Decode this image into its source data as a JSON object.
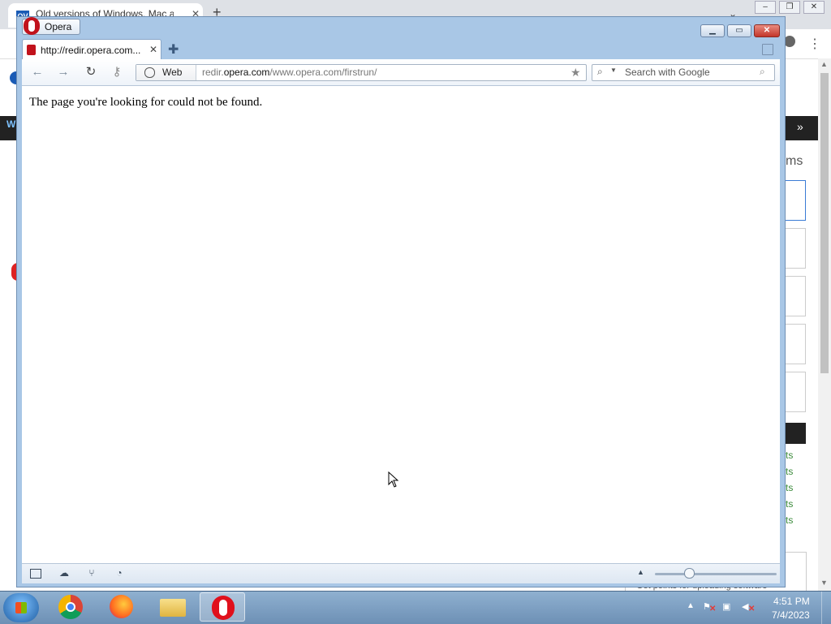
{
  "background_browser": {
    "tab_favicon_text": "OV",
    "tab_title": "Old versions of Windows, Mac a",
    "sidebar_heading": "ms",
    "footer_text": "Get points for uploading software",
    "left_fragment": "W",
    "link_fragments": [
      "ts",
      "ts",
      "ts",
      "ts",
      "ts"
    ]
  },
  "opera": {
    "menu_label": "Opera",
    "window_controls": {
      "minimize": "▁",
      "maximize": "▭",
      "close": "✕"
    },
    "tab": {
      "title": "http://redir.opera.com..."
    },
    "address": {
      "badge": "Web",
      "url_prefix": "redir.",
      "url_domain": "opera.com",
      "url_path": "/www.opera.com/firstrun/"
    },
    "search": {
      "placeholder": "Search with Google"
    },
    "content": {
      "message": "The page you're looking for could not be found."
    }
  },
  "taskbar": {
    "apps": [
      "Chrome",
      "Firefox",
      "Windows Explorer",
      "Opera"
    ],
    "active_app": "Opera",
    "clock": {
      "time": "4:51 PM",
      "date": "7/4/2023"
    }
  },
  "colors": {
    "opera_frame": "#a9c7e6",
    "opera_brand": "#c1121c",
    "taskbar": "#7a9cc0"
  }
}
